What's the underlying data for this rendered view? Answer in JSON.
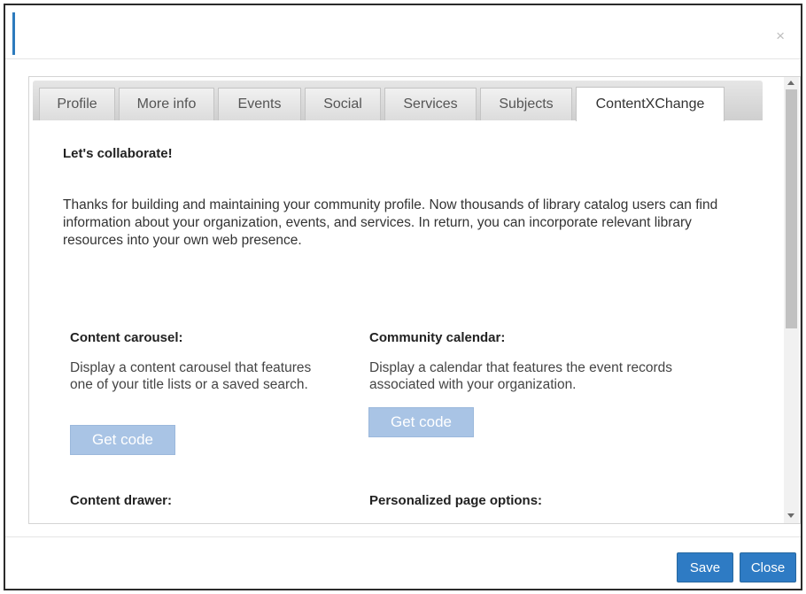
{
  "tabs": [
    {
      "label": "Profile",
      "active": false
    },
    {
      "label": "More info",
      "active": false
    },
    {
      "label": "Events",
      "active": false
    },
    {
      "label": "Social",
      "active": false
    },
    {
      "label": "Services",
      "active": false
    },
    {
      "label": "Subjects",
      "active": false
    },
    {
      "label": "ContentXChange",
      "active": true
    }
  ],
  "close_icon": "×",
  "heading": "Let's collaborate!",
  "intro": "Thanks for building and maintaining your community profile. Now thousands of library catalog users can find information about your organization, events, and services. In return, you can incorporate relevant library resources into your own web presence.",
  "sections": {
    "carousel": {
      "title": "Content carousel:",
      "description": "Display a content carousel that features one of your title lists or a saved search.",
      "button": "Get code"
    },
    "calendar": {
      "title": "Community calendar:",
      "description": "Display a calendar that features the event records associated with your organization.",
      "button": "Get code"
    },
    "drawer": {
      "title": "Content drawer:"
    },
    "personalized": {
      "title": "Personalized page options:"
    }
  },
  "footer": {
    "save_label": "Save",
    "close_label": "Close"
  },
  "colors": {
    "primary_button": "#2e7bc4",
    "get_code_button": "#a9c4e5"
  }
}
